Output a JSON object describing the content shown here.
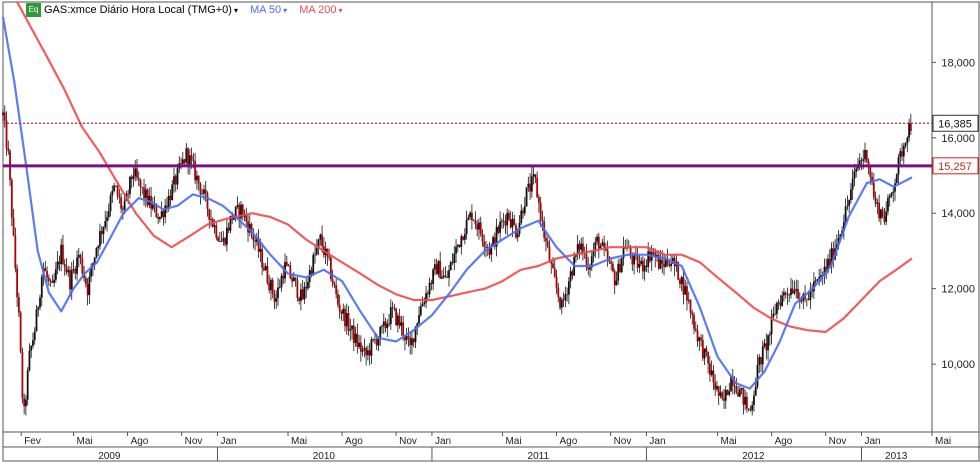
{
  "legend": {
    "badge": "Eq",
    "instrument": "GAS:xmce Diário Hora Local (TMG+0)",
    "ma50_label": "MA 50",
    "ma200_label": "MA 200",
    "arrow": "▾"
  },
  "colors": {
    "price": "#111111",
    "price_down": "#b00000",
    "ma50": "#4a6ef0",
    "ma200": "#ef4a4a",
    "hline": "#7a1080",
    "price_line": "#d02020",
    "badge": "#2e9a3a"
  },
  "chart_data": {
    "type": "candlestick",
    "x_start": "2009-01",
    "x_end": "2013-05",
    "ylim": [
      8.2,
      19.6
    ],
    "y_ticks": [
      "10,000",
      "12,000",
      "14,000",
      "16,000",
      "18,000"
    ],
    "y_tick_values": [
      10,
      12,
      14,
      16,
      18
    ],
    "month_labels": [
      {
        "date": "2009-02",
        "label": "Fev"
      },
      {
        "date": "2009-05",
        "label": "Mai"
      },
      {
        "date": "2009-08",
        "label": "Ago"
      },
      {
        "date": "2009-11",
        "label": "Nov"
      },
      {
        "date": "2010-01",
        "label": "Jan"
      },
      {
        "date": "2010-05",
        "label": "Mai"
      },
      {
        "date": "2010-08",
        "label": "Ago"
      },
      {
        "date": "2010-11",
        "label": "Nov"
      },
      {
        "date": "2011-01",
        "label": "Jan"
      },
      {
        "date": "2011-05",
        "label": "Mai"
      },
      {
        "date": "2011-08",
        "label": "Ago"
      },
      {
        "date": "2011-11",
        "label": "Nov"
      },
      {
        "date": "2012-01",
        "label": "Jan"
      },
      {
        "date": "2012-05",
        "label": "Mai"
      },
      {
        "date": "2012-08",
        "label": "Ago"
      },
      {
        "date": "2012-11",
        "label": "Nov"
      },
      {
        "date": "2013-01",
        "label": "Jan"
      },
      {
        "date": "2013-05",
        "label": "Mai"
      }
    ],
    "year_labels": [
      {
        "date": "2009-07",
        "label": "2009"
      },
      {
        "date": "2010-07",
        "label": "2010"
      },
      {
        "date": "2011-07",
        "label": "2011"
      },
      {
        "date": "2012-07",
        "label": "2012"
      },
      {
        "date": "2013-03",
        "label": "2013"
      }
    ],
    "year_separators": [
      "2010-01",
      "2011-01",
      "2012-01",
      "2013-01"
    ],
    "price_path": [
      [
        "2009-01-01",
        16.6
      ],
      [
        "2009-01-10",
        15.5
      ],
      [
        "2009-01-20",
        13.0
      ],
      [
        "2009-01-28",
        11.2
      ],
      [
        "2009-02-05",
        8.5
      ],
      [
        "2009-02-15",
        10.2
      ],
      [
        "2009-02-25",
        11.0
      ],
      [
        "2009-03-10",
        12.6
      ],
      [
        "2009-03-25",
        11.9
      ],
      [
        "2009-04-10",
        13.0
      ],
      [
        "2009-04-25",
        12.2
      ],
      [
        "2009-05-10",
        12.9
      ],
      [
        "2009-05-25",
        12.0
      ],
      [
        "2009-06-10",
        13.2
      ],
      [
        "2009-06-25",
        13.9
      ],
      [
        "2009-07-10",
        14.7
      ],
      [
        "2009-07-25",
        14.0
      ],
      [
        "2009-08-10",
        15.1
      ],
      [
        "2009-08-25",
        14.6
      ],
      [
        "2009-09-10",
        14.2
      ],
      [
        "2009-09-25",
        13.9
      ],
      [
        "2009-10-10",
        14.4
      ],
      [
        "2009-10-25",
        15.0
      ],
      [
        "2009-11-10",
        15.6
      ],
      [
        "2009-11-25",
        15.0
      ],
      [
        "2009-12-10",
        14.4
      ],
      [
        "2009-12-25",
        13.7
      ],
      [
        "2010-01-10",
        13.2
      ],
      [
        "2010-01-25",
        13.9
      ],
      [
        "2010-02-10",
        14.1
      ],
      [
        "2010-02-25",
        13.6
      ],
      [
        "2010-03-10",
        13.1
      ],
      [
        "2010-03-25",
        12.4
      ],
      [
        "2010-04-10",
        11.7
      ],
      [
        "2010-04-25",
        12.6
      ],
      [
        "2010-05-10",
        12.2
      ],
      [
        "2010-05-25",
        11.7
      ],
      [
        "2010-06-10",
        12.6
      ],
      [
        "2010-06-25",
        13.3
      ],
      [
        "2010-07-10",
        12.6
      ],
      [
        "2010-07-25",
        11.6
      ],
      [
        "2010-08-10",
        11.1
      ],
      [
        "2010-08-25",
        10.6
      ],
      [
        "2010-09-10",
        10.2
      ],
      [
        "2010-09-25",
        10.6
      ],
      [
        "2010-10-10",
        10.9
      ],
      [
        "2010-10-25",
        11.4
      ],
      [
        "2010-11-10",
        11.0
      ],
      [
        "2010-11-25",
        10.4
      ],
      [
        "2010-12-10",
        11.4
      ],
      [
        "2010-12-25",
        12.0
      ],
      [
        "2011-01-10",
        12.6
      ],
      [
        "2011-01-25",
        12.2
      ],
      [
        "2011-02-10",
        13.0
      ],
      [
        "2011-02-25",
        13.6
      ],
      [
        "2011-03-10",
        14.0
      ],
      [
        "2011-03-25",
        13.5
      ],
      [
        "2011-04-10",
        13.0
      ],
      [
        "2011-04-25",
        13.6
      ],
      [
        "2011-05-10",
        14.0
      ],
      [
        "2011-05-25",
        13.5
      ],
      [
        "2011-06-10",
        14.5
      ],
      [
        "2011-06-25",
        14.9
      ],
      [
        "2011-07-10",
        13.5
      ],
      [
        "2011-07-25",
        12.4
      ],
      [
        "2011-08-10",
        11.5
      ],
      [
        "2011-08-25",
        12.4
      ],
      [
        "2011-09-10",
        13.2
      ],
      [
        "2011-09-25",
        12.6
      ],
      [
        "2011-10-10",
        13.3
      ],
      [
        "2011-10-25",
        12.8
      ],
      [
        "2011-11-10",
        12.2
      ],
      [
        "2011-11-25",
        13.2
      ],
      [
        "2011-12-10",
        12.7
      ],
      [
        "2011-12-25",
        12.6
      ],
      [
        "2012-01-10",
        13.0
      ],
      [
        "2012-01-25",
        12.6
      ],
      [
        "2012-02-10",
        12.8
      ],
      [
        "2012-02-25",
        12.4
      ],
      [
        "2012-03-10",
        11.8
      ],
      [
        "2012-03-25",
        10.9
      ],
      [
        "2012-04-10",
        10.2
      ],
      [
        "2012-04-25",
        9.5
      ],
      [
        "2012-05-10",
        8.9
      ],
      [
        "2012-05-25",
        9.7
      ],
      [
        "2012-06-10",
        9.2
      ],
      [
        "2012-06-25",
        8.7
      ],
      [
        "2012-07-10",
        10.0
      ],
      [
        "2012-07-25",
        10.6
      ],
      [
        "2012-08-10",
        11.6
      ],
      [
        "2012-08-25",
        11.9
      ],
      [
        "2012-09-10",
        12.1
      ],
      [
        "2012-09-25",
        11.6
      ],
      [
        "2012-10-10",
        12.0
      ],
      [
        "2012-10-25",
        12.3
      ],
      [
        "2012-11-10",
        12.8
      ],
      [
        "2012-11-25",
        13.5
      ],
      [
        "2012-12-10",
        14.3
      ],
      [
        "2012-12-25",
        15.3
      ],
      [
        "2013-01-10",
        15.6
      ],
      [
        "2013-01-25",
        14.2
      ],
      [
        "2013-02-10",
        13.9
      ],
      [
        "2013-02-25",
        14.8
      ],
      [
        "2013-03-10",
        15.6
      ],
      [
        "2013-03-20",
        16.2
      ],
      [
        "2013-03-28",
        16.4
      ]
    ],
    "ma50_path": [
      [
        "2009-01-01",
        19.2
      ],
      [
        "2009-01-20",
        17.5
      ],
      [
        "2009-02-10",
        15.2
      ],
      [
        "2009-03-01",
        13.0
      ],
      [
        "2009-03-20",
        11.9
      ],
      [
        "2009-04-10",
        11.4
      ],
      [
        "2009-05-01",
        12.0
      ],
      [
        "2009-05-20",
        12.4
      ],
      [
        "2009-06-10",
        12.7
      ],
      [
        "2009-07-01",
        13.3
      ],
      [
        "2009-07-25",
        14.0
      ],
      [
        "2009-08-20",
        14.4
      ],
      [
        "2009-09-10",
        14.3
      ],
      [
        "2009-10-01",
        14.1
      ],
      [
        "2009-10-25",
        14.2
      ],
      [
        "2009-11-20",
        14.5
      ],
      [
        "2009-12-15",
        14.4
      ],
      [
        "2010-01-10",
        14.2
      ],
      [
        "2010-02-01",
        13.9
      ],
      [
        "2010-03-01",
        13.5
      ],
      [
        "2010-04-01",
        12.9
      ],
      [
        "2010-05-01",
        12.4
      ],
      [
        "2010-06-01",
        12.3
      ],
      [
        "2010-07-01",
        12.5
      ],
      [
        "2010-08-01",
        12.2
      ],
      [
        "2010-09-01",
        11.4
      ],
      [
        "2010-10-01",
        10.7
      ],
      [
        "2010-11-01",
        10.6
      ],
      [
        "2010-12-01",
        10.9
      ],
      [
        "2011-01-01",
        11.3
      ],
      [
        "2011-02-01",
        11.9
      ],
      [
        "2011-03-01",
        12.5
      ],
      [
        "2011-04-01",
        13.0
      ],
      [
        "2011-05-01",
        13.3
      ],
      [
        "2011-06-01",
        13.6
      ],
      [
        "2011-07-01",
        13.8
      ],
      [
        "2011-08-01",
        13.1
      ],
      [
        "2011-09-01",
        12.6
      ],
      [
        "2011-10-01",
        12.6
      ],
      [
        "2011-11-01",
        12.8
      ],
      [
        "2011-12-01",
        12.9
      ],
      [
        "2012-01-01",
        12.9
      ],
      [
        "2012-02-01",
        12.8
      ],
      [
        "2012-03-01",
        12.6
      ],
      [
        "2012-04-01",
        11.5
      ],
      [
        "2012-05-01",
        10.2
      ],
      [
        "2012-06-01",
        9.5
      ],
      [
        "2012-06-25",
        9.35
      ],
      [
        "2012-07-20",
        9.8
      ],
      [
        "2012-08-15",
        10.6
      ],
      [
        "2012-09-10",
        11.6
      ],
      [
        "2012-10-10",
        12.0
      ],
      [
        "2012-11-10",
        12.6
      ],
      [
        "2012-12-10",
        13.9
      ],
      [
        "2013-01-10",
        14.8
      ],
      [
        "2013-02-01",
        14.9
      ],
      [
        "2013-02-25",
        14.7
      ],
      [
        "2013-03-28",
        14.95
      ]
    ],
    "ma200_path": [
      [
        "2009-01-25",
        19.6
      ],
      [
        "2009-02-15",
        19.0
      ],
      [
        "2009-03-15",
        18.2
      ],
      [
        "2009-04-15",
        17.3
      ],
      [
        "2009-05-15",
        16.3
      ],
      [
        "2009-06-15",
        15.6
      ],
      [
        "2009-07-15",
        14.8
      ],
      [
        "2009-08-15",
        14.0
      ],
      [
        "2009-09-15",
        13.4
      ],
      [
        "2009-10-15",
        13.1
      ],
      [
        "2009-11-15",
        13.4
      ],
      [
        "2009-12-15",
        13.7
      ],
      [
        "2010-01-15",
        13.85
      ],
      [
        "2010-03-01",
        14.0
      ],
      [
        "2010-04-01",
        13.9
      ],
      [
        "2010-05-01",
        13.7
      ],
      [
        "2010-06-01",
        13.3
      ],
      [
        "2010-07-01",
        13.0
      ],
      [
        "2010-08-01",
        12.7
      ],
      [
        "2010-09-01",
        12.4
      ],
      [
        "2010-10-01",
        12.1
      ],
      [
        "2010-11-01",
        11.85
      ],
      [
        "2010-12-01",
        11.7
      ],
      [
        "2011-01-01",
        11.7
      ],
      [
        "2011-02-01",
        11.8
      ],
      [
        "2011-03-01",
        11.9
      ],
      [
        "2011-04-01",
        12.0
      ],
      [
        "2011-05-01",
        12.2
      ],
      [
        "2011-06-01",
        12.5
      ],
      [
        "2011-07-01",
        12.6
      ],
      [
        "2011-08-01",
        12.8
      ],
      [
        "2011-09-01",
        12.9
      ],
      [
        "2011-10-01",
        13.0
      ],
      [
        "2011-11-01",
        13.1
      ],
      [
        "2011-12-01",
        13.1
      ],
      [
        "2012-01-01",
        13.1
      ],
      [
        "2012-02-01",
        12.9
      ],
      [
        "2012-03-01",
        12.9
      ],
      [
        "2012-04-01",
        12.7
      ],
      [
        "2012-05-01",
        12.3
      ],
      [
        "2012-06-01",
        11.9
      ],
      [
        "2012-07-01",
        11.5
      ],
      [
        "2012-08-01",
        11.2
      ],
      [
        "2012-09-01",
        11.0
      ],
      [
        "2012-10-01",
        10.9
      ],
      [
        "2012-11-01",
        10.85
      ],
      [
        "2012-12-01",
        11.2
      ],
      [
        "2013-01-01",
        11.7
      ],
      [
        "2013-02-01",
        12.2
      ],
      [
        "2013-03-01",
        12.5
      ],
      [
        "2013-03-28",
        12.8
      ]
    ],
    "hline_value": 15.257,
    "hline_label": "15,257",
    "last_price": 16.385,
    "last_price_label": "16,385"
  }
}
